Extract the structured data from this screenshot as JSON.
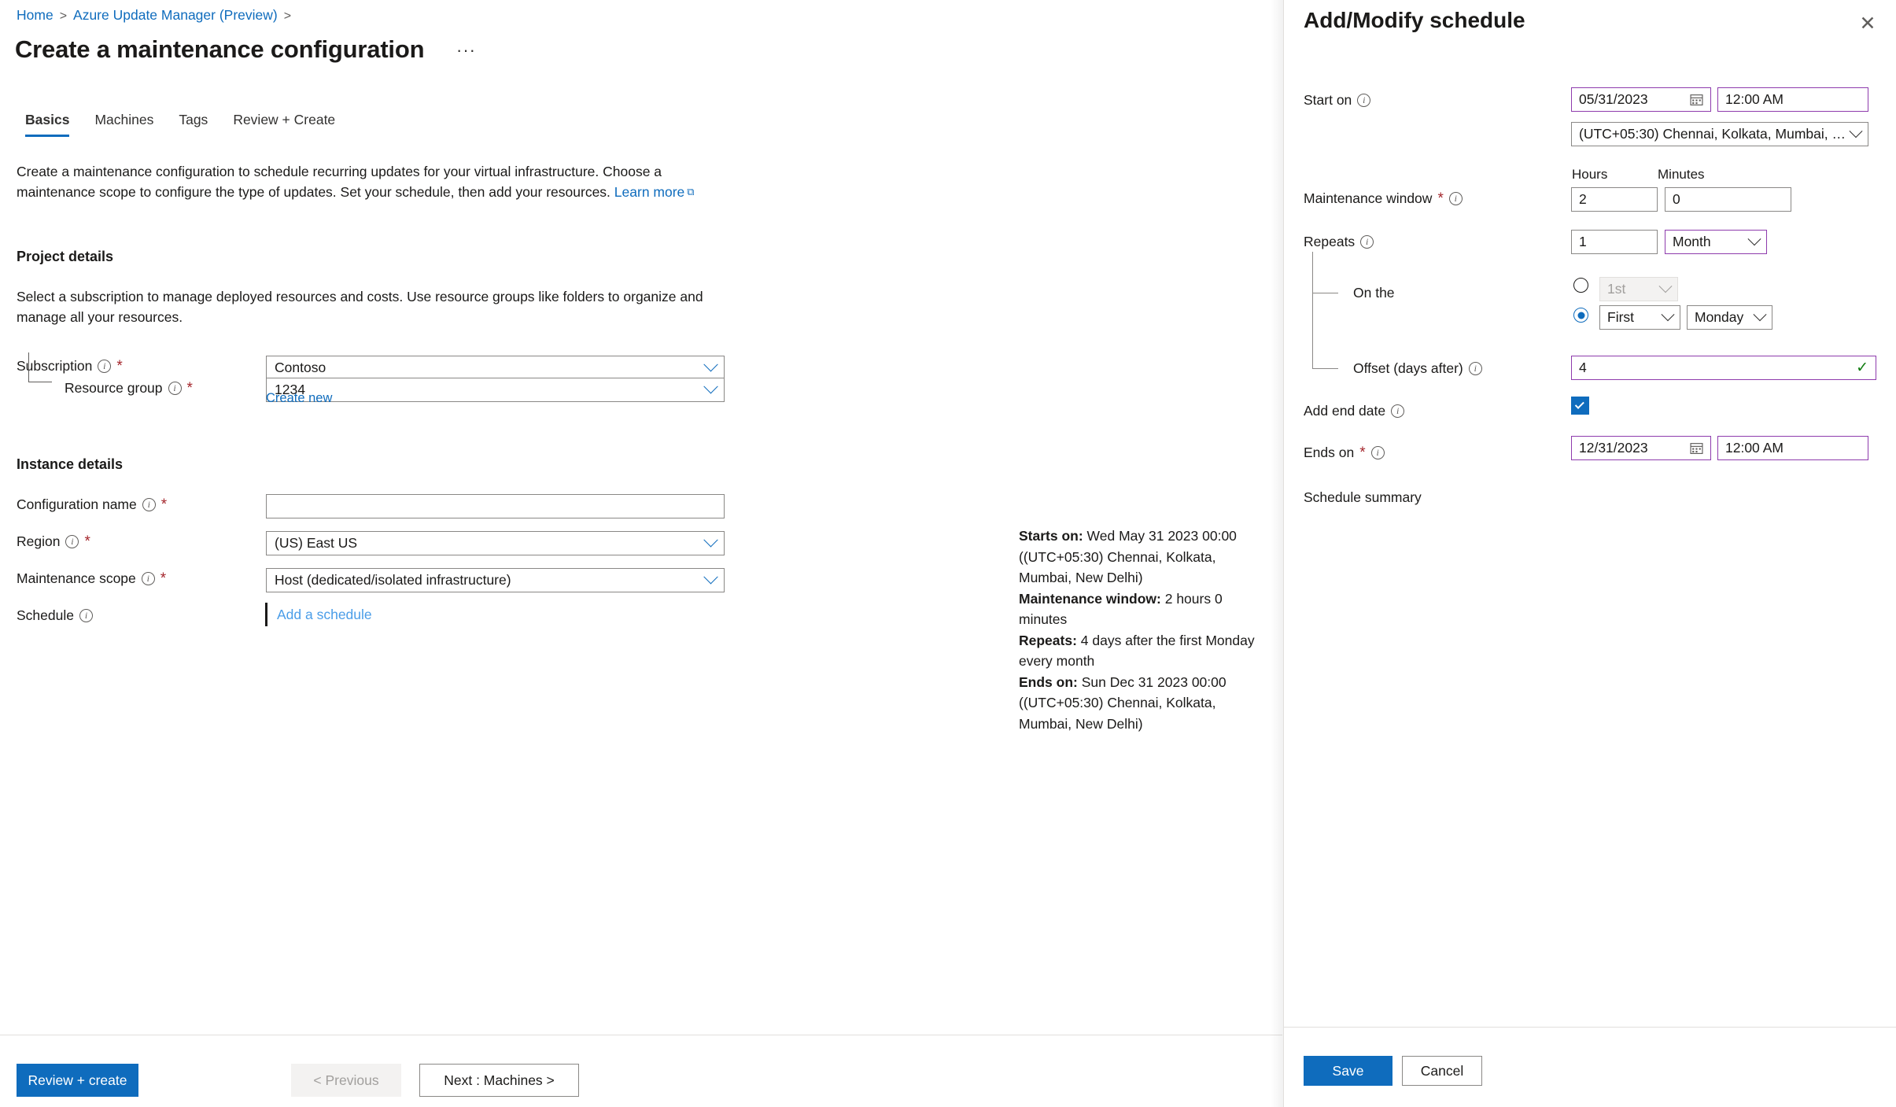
{
  "breadcrumb": {
    "home": "Home",
    "section": "Azure Update Manager (Preview)"
  },
  "page": {
    "title": "Create a maintenance configuration",
    "ellipsis": "···",
    "intro_text": "Create a maintenance configuration to schedule recurring updates for your virtual infrastructure. Choose a maintenance scope to configure the type of updates. Set your schedule, then add your resources.",
    "intro_link": "Learn more"
  },
  "tabs": [
    {
      "label": "Basics",
      "active": true
    },
    {
      "label": "Machines",
      "active": false
    },
    {
      "label": "Tags",
      "active": false
    },
    {
      "label": "Review + Create",
      "active": false
    }
  ],
  "project_details": {
    "heading": "Project details",
    "description": "Select a subscription to manage deployed resources and costs. Use resource groups like folders to organize and manage all your resources.",
    "subscription": {
      "label": "Subscription",
      "value": "Contoso",
      "required": true
    },
    "resource_group": {
      "label": "Resource group",
      "value": "1234",
      "required": true
    },
    "create_new": "Create new"
  },
  "instance_details": {
    "heading": "Instance details",
    "configuration_name": {
      "label": "Configuration name",
      "value": "",
      "required": true
    },
    "region": {
      "label": "Region",
      "value": "(US) East US",
      "required": true
    },
    "maintenance_scope": {
      "label": "Maintenance scope",
      "value": "Host (dedicated/isolated infrastructure)",
      "required": true
    },
    "schedule": {
      "label": "Schedule",
      "link": "Add a schedule"
    }
  },
  "footer": {
    "review_create": "Review + create",
    "previous": "< Previous",
    "next": "Next : Machines >"
  },
  "panel": {
    "title": "Add/Modify schedule",
    "close_label": "✕",
    "start_on": {
      "label": "Start on",
      "date": "05/31/2023",
      "time": "12:00 AM",
      "timezone": "(UTC+05:30) Chennai, Kolkata, Mumbai, N..."
    },
    "maintenance_window": {
      "label": "Maintenance window",
      "required": true,
      "hours_header": "Hours",
      "minutes_header": "Minutes",
      "hours": "2",
      "minutes": "0"
    },
    "repeats": {
      "label": "Repeats",
      "count": "1",
      "unit": "Month"
    },
    "on_the": {
      "label": "On the",
      "day_ordinal": "1st",
      "selected": false,
      "week_ordinal": "First",
      "weekday": "Monday",
      "weekday_selected": true
    },
    "offset": {
      "label": "Offset (days after)",
      "value": "4"
    },
    "add_end_date": {
      "label": "Add end date",
      "checked": true
    },
    "ends_on": {
      "label": "Ends on",
      "required": true,
      "date": "12/31/2023",
      "time": "12:00 AM"
    },
    "schedule_summary": {
      "label": "Schedule summary",
      "starts_on_label": "Starts on:",
      "starts_on_value": " Wed May 31 2023 00:00 ((UTC+05:30) Chennai, Kolkata, Mumbai, New Delhi)",
      "window_label": "Maintenance window:",
      "window_value": " 2 hours 0 minutes",
      "repeats_label": "Repeats:",
      "repeats_value": " 4 days after the first Monday every month",
      "ends_on_label": "Ends on:",
      "ends_on_value": " Sun Dec 31 2023 00:00 ((UTC+05:30) Chennai, Kolkata, Mumbai, New Delhi)"
    },
    "save": "Save",
    "cancel": "Cancel"
  },
  "colors": {
    "accent_blue": "#0f6cbd",
    "link_blue": "#0f6cbd",
    "required_red": "#a4262c",
    "focus_purple": "#8e3bad",
    "valid_green": "#107c10"
  }
}
